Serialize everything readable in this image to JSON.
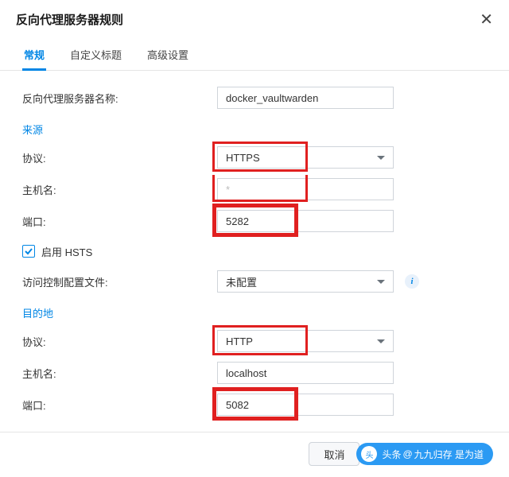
{
  "dialog": {
    "title": "反向代理服务器规则"
  },
  "tabs": {
    "general": "常规",
    "custom": "自定义标题",
    "advanced": "高级设置"
  },
  "form": {
    "name_label": "反向代理服务器名称:",
    "name_value": "docker_vaultwarden",
    "source": {
      "title": "来源",
      "proto_label": "协议:",
      "proto_value": "HTTPS",
      "host_label": "主机名:",
      "host_placeholder": "*",
      "port_label": "端口:",
      "port_value": "5282",
      "hsts_label": "启用 HSTS",
      "acl_label": "访问控制配置文件:",
      "acl_value": "未配置"
    },
    "dest": {
      "title": "目的地",
      "proto_label": "协议:",
      "proto_value": "HTTP",
      "host_label": "主机名:",
      "host_value": "localhost",
      "port_label": "端口:",
      "port_value": "5082"
    }
  },
  "footer": {
    "cancel": "取消",
    "watermark_prefix": "头条",
    "watermark": "九九归存 是为道"
  },
  "colors": {
    "accent": "#0086e5",
    "highlight": "#e02020"
  }
}
